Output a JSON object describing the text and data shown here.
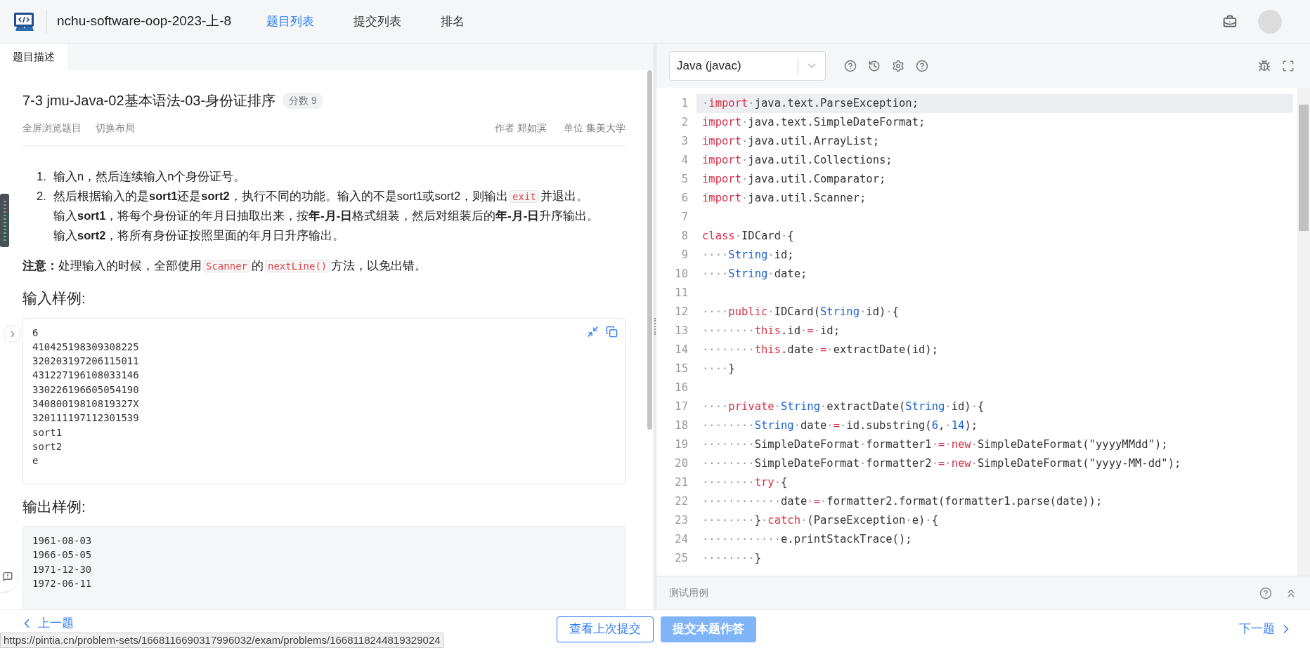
{
  "header": {
    "title": "nchu-software-oop-2023-上-8",
    "nav": [
      {
        "label": "题目列表",
        "selected": true
      },
      {
        "label": "提交列表",
        "selected": false
      },
      {
        "label": "排名",
        "selected": false
      }
    ]
  },
  "left_tabs": [
    {
      "label": "题目描述",
      "selected": true
    }
  ],
  "problem": {
    "title": "7-3 jmu-Java-02基本语法-03-身份证排序",
    "score": "分数 9",
    "actions": [
      "全屏浏览题目",
      "切换布局"
    ],
    "meta": [
      {
        "label": "作者",
        "value": "郑如滨"
      },
      {
        "label": "单位",
        "value": "集美大学"
      }
    ],
    "list": [
      {
        "number": "1.",
        "lines": [
          [
            {
              "kind": "text",
              "text": "输入n，然后连续输入n个身份证号。"
            }
          ]
        ]
      },
      {
        "number": "2.",
        "lines": [
          [
            {
              "kind": "text",
              "text": "然后根据输入的是**sort1**还是**sort2**，执行不同的功能。输入的不是sort1或sort2，则输出"
            },
            {
              "kind": "code",
              "text": "exit"
            },
            {
              "kind": "text",
              "text": "并退出。"
            }
          ],
          [
            {
              "kind": "text",
              "text": "输入**sort1**，将每个身份证的年月日抽取出来，按**年-月-日**格式组装，然后对组装后的**年-月-日**升序输出。"
            }
          ],
          [
            {
              "kind": "text",
              "text": "输入**sort2**，将所有身份证按照里面的年月日升序输出。"
            }
          ]
        ]
      }
    ],
    "note": [
      {
        "kind": "text",
        "text": "**注意：**处理输入的时候，全部使用"
      },
      {
        "kind": "code",
        "text": "Scanner"
      },
      {
        "kind": "text",
        "text": "的"
      },
      {
        "kind": "code",
        "text": "nextLine()"
      },
      {
        "kind": "text",
        "text": "方法，以免出错。"
      }
    ],
    "samples": [
      {
        "heading": "输入样例:",
        "kind": "input",
        "lines": [
          "6",
          "410425198309308225",
          "320203197206115011",
          "431227196108033146",
          "330226196605054190",
          "34080019810819327X",
          "320111197112301539",
          "sort1",
          "sort2",
          "e"
        ]
      },
      {
        "heading": "输出样例:",
        "kind": "output",
        "lines": [
          "1961-08-03",
          "1966-05-05",
          "1971-12-30",
          "1972-06-11"
        ]
      }
    ]
  },
  "editor": {
    "language": "Java (javac)",
    "lines": [
      {
        "number": "1",
        "active": true,
        "tokens": [
          {
            "kind": "ws",
            "text": "·"
          },
          {
            "kind": "kw",
            "text": "import"
          },
          {
            "kind": "ws",
            "text": "·"
          },
          {
            "kind": "plain",
            "text": "java.text.ParseException;"
          }
        ]
      },
      {
        "number": "2",
        "active": false,
        "tokens": [
          {
            "kind": "kw",
            "text": "import"
          },
          {
            "kind": "ws",
            "text": "·"
          },
          {
            "kind": "plain",
            "text": "java.text.SimpleDateFormat;"
          }
        ]
      },
      {
        "number": "3",
        "active": false,
        "tokens": [
          {
            "kind": "kw",
            "text": "import"
          },
          {
            "kind": "ws",
            "text": "·"
          },
          {
            "kind": "plain",
            "text": "java.util.ArrayList;"
          }
        ]
      },
      {
        "number": "4",
        "active": false,
        "tokens": [
          {
            "kind": "kw",
            "text": "import"
          },
          {
            "kind": "ws",
            "text": "·"
          },
          {
            "kind": "plain",
            "text": "java.util.Collections;"
          }
        ]
      },
      {
        "number": "5",
        "active": false,
        "tokens": [
          {
            "kind": "kw",
            "text": "import"
          },
          {
            "kind": "ws",
            "text": "·"
          },
          {
            "kind": "plain",
            "text": "java.util.Comparator;"
          }
        ]
      },
      {
        "number": "6",
        "active": false,
        "tokens": [
          {
            "kind": "kw",
            "text": "import"
          },
          {
            "kind": "ws",
            "text": "·"
          },
          {
            "kind": "plain",
            "text": "java.util.Scanner;"
          }
        ]
      },
      {
        "number": "7",
        "active": false
      },
      {
        "number": "8",
        "active": false,
        "tokens": [
          {
            "kind": "kw",
            "text": "class"
          },
          {
            "kind": "ws",
            "text": "·"
          },
          {
            "kind": "plain",
            "text": "IDCard"
          },
          {
            "kind": "ws",
            "text": "·"
          },
          {
            "kind": "plain",
            "text": "{"
          }
        ]
      },
      {
        "number": "9",
        "active": false,
        "tokens": [
          {
            "kind": "ws",
            "text": "····"
          },
          {
            "kind": "type",
            "text": "String"
          },
          {
            "kind": "ws",
            "text": "·"
          },
          {
            "kind": "plain",
            "text": "id;"
          }
        ]
      },
      {
        "number": "10",
        "active": false,
        "tokens": [
          {
            "kind": "ws",
            "text": "····"
          },
          {
            "kind": "type",
            "text": "String"
          },
          {
            "kind": "ws",
            "text": "·"
          },
          {
            "kind": "plain",
            "text": "date;"
          }
        ]
      },
      {
        "number": "11",
        "active": false
      },
      {
        "number": "12",
        "active": false,
        "tokens": [
          {
            "kind": "ws",
            "text": "····"
          },
          {
            "kind": "kw",
            "text": "public"
          },
          {
            "kind": "ws",
            "text": "·"
          },
          {
            "kind": "plain",
            "text": "IDCard("
          },
          {
            "kind": "type",
            "text": "String"
          },
          {
            "kind": "ws",
            "text": "·"
          },
          {
            "kind": "plain",
            "text": "id)"
          },
          {
            "kind": "ws",
            "text": "·"
          },
          {
            "kind": "plain",
            "text": "{"
          }
        ]
      },
      {
        "number": "13",
        "active": false,
        "tokens": [
          {
            "kind": "ws",
            "text": "········"
          },
          {
            "kind": "kw",
            "text": "this"
          },
          {
            "kind": "plain",
            "text": ".id"
          },
          {
            "kind": "ws",
            "text": "·"
          },
          {
            "kind": "kw",
            "text": "="
          },
          {
            "kind": "ws",
            "text": "·"
          },
          {
            "kind": "plain",
            "text": "id;"
          }
        ]
      },
      {
        "number": "14",
        "active": false,
        "tokens": [
          {
            "kind": "ws",
            "text": "········"
          },
          {
            "kind": "kw",
            "text": "this"
          },
          {
            "kind": "plain",
            "text": ".date"
          },
          {
            "kind": "ws",
            "text": "·"
          },
          {
            "kind": "kw",
            "text": "="
          },
          {
            "kind": "ws",
            "text": "·"
          },
          {
            "kind": "plain",
            "text": "extractDate(id);"
          }
        ]
      },
      {
        "number": "15",
        "active": false,
        "tokens": [
          {
            "kind": "ws",
            "text": "····"
          },
          {
            "kind": "plain",
            "text": "}"
          }
        ]
      },
      {
        "number": "16",
        "active": false
      },
      {
        "number": "17",
        "active": false,
        "tokens": [
          {
            "kind": "ws",
            "text": "····"
          },
          {
            "kind": "kw",
            "text": "private"
          },
          {
            "kind": "ws",
            "text": "·"
          },
          {
            "kind": "type",
            "text": "String"
          },
          {
            "kind": "ws",
            "text": "·"
          },
          {
            "kind": "plain",
            "text": "extractDate("
          },
          {
            "kind": "type",
            "text": "String"
          },
          {
            "kind": "ws",
            "text": "·"
          },
          {
            "kind": "plain",
            "text": "id)"
          },
          {
            "kind": "ws",
            "text": "·"
          },
          {
            "kind": "plain",
            "text": "{"
          }
        ]
      },
      {
        "number": "18",
        "active": false,
        "tokens": [
          {
            "kind": "ws",
            "text": "········"
          },
          {
            "kind": "type",
            "text": "String"
          },
          {
            "kind": "ws",
            "text": "·"
          },
          {
            "kind": "plain",
            "text": "date"
          },
          {
            "kind": "ws",
            "text": "·"
          },
          {
            "kind": "kw",
            "text": "="
          },
          {
            "kind": "ws",
            "text": "·"
          },
          {
            "kind": "plain",
            "text": "id.substring("
          },
          {
            "kind": "type",
            "text": "6"
          },
          {
            "kind": "plain",
            "text": ","
          },
          {
            "kind": "ws",
            "text": "·"
          },
          {
            "kind": "type",
            "text": "14"
          },
          {
            "kind": "plain",
            "text": ");"
          }
        ]
      },
      {
        "number": "19",
        "active": false,
        "tokens": [
          {
            "kind": "ws",
            "text": "········"
          },
          {
            "kind": "plain",
            "text": "SimpleDateFormat"
          },
          {
            "kind": "ws",
            "text": "·"
          },
          {
            "kind": "plain",
            "text": "formatter1"
          },
          {
            "kind": "ws",
            "text": "·"
          },
          {
            "kind": "kw",
            "text": "="
          },
          {
            "kind": "ws",
            "text": "·"
          },
          {
            "kind": "kw",
            "text": "new"
          },
          {
            "kind": "ws",
            "text": "·"
          },
          {
            "kind": "plain",
            "text": "SimpleDateFormat(\"yyyyMMdd\");"
          }
        ]
      },
      {
        "number": "20",
        "active": false,
        "tokens": [
          {
            "kind": "ws",
            "text": "········"
          },
          {
            "kind": "plain",
            "text": "SimpleDateFormat"
          },
          {
            "kind": "ws",
            "text": "·"
          },
          {
            "kind": "plain",
            "text": "formatter2"
          },
          {
            "kind": "ws",
            "text": "·"
          },
          {
            "kind": "kw",
            "text": "="
          },
          {
            "kind": "ws",
            "text": "·"
          },
          {
            "kind": "kw",
            "text": "new"
          },
          {
            "kind": "ws",
            "text": "·"
          },
          {
            "kind": "plain",
            "text": "SimpleDateFormat(\"yyyy-MM-dd\");"
          }
        ]
      },
      {
        "number": "21",
        "active": false,
        "tokens": [
          {
            "kind": "ws",
            "text": "········"
          },
          {
            "kind": "kw",
            "text": "try"
          },
          {
            "kind": "ws",
            "text": "·"
          },
          {
            "kind": "plain",
            "text": "{"
          }
        ]
      },
      {
        "number": "22",
        "active": false,
        "tokens": [
          {
            "kind": "ws",
            "text": "············"
          },
          {
            "kind": "plain",
            "text": "date"
          },
          {
            "kind": "ws",
            "text": "·"
          },
          {
            "kind": "kw",
            "text": "="
          },
          {
            "kind": "ws",
            "text": "·"
          },
          {
            "kind": "plain",
            "text": "formatter2.format(formatter1.parse(date));"
          }
        ]
      },
      {
        "number": "23",
        "active": false,
        "tokens": [
          {
            "kind": "ws",
            "text": "········"
          },
          {
            "kind": "plain",
            "text": "}"
          },
          {
            "kind": "ws",
            "text": "·"
          },
          {
            "kind": "kw",
            "text": "catch"
          },
          {
            "kind": "ws",
            "text": "·"
          },
          {
            "kind": "plain",
            "text": "(ParseException"
          },
          {
            "kind": "ws",
            "text": "·"
          },
          {
            "kind": "plain",
            "text": "e)"
          },
          {
            "kind": "ws",
            "text": "·"
          },
          {
            "kind": "plain",
            "text": "{"
          }
        ]
      },
      {
        "number": "24",
        "active": false,
        "tokens": [
          {
            "kind": "ws",
            "text": "············"
          },
          {
            "kind": "plain",
            "text": "e.printStackTrace();"
          }
        ]
      },
      {
        "number": "25",
        "active": false,
        "tokens": [
          {
            "kind": "ws",
            "text": "········"
          },
          {
            "kind": "plain",
            "text": "}"
          }
        ]
      }
    ]
  },
  "test_panel": {
    "label": "测试用例"
  },
  "footer": {
    "prev": "上一题",
    "view_last": "查看上次提交",
    "submit": "提交本题作答",
    "next": "下一题"
  },
  "status_url": "https://pintia.cn/problem-sets/1668116690317996032/exam/problems/1668118244819329024"
}
